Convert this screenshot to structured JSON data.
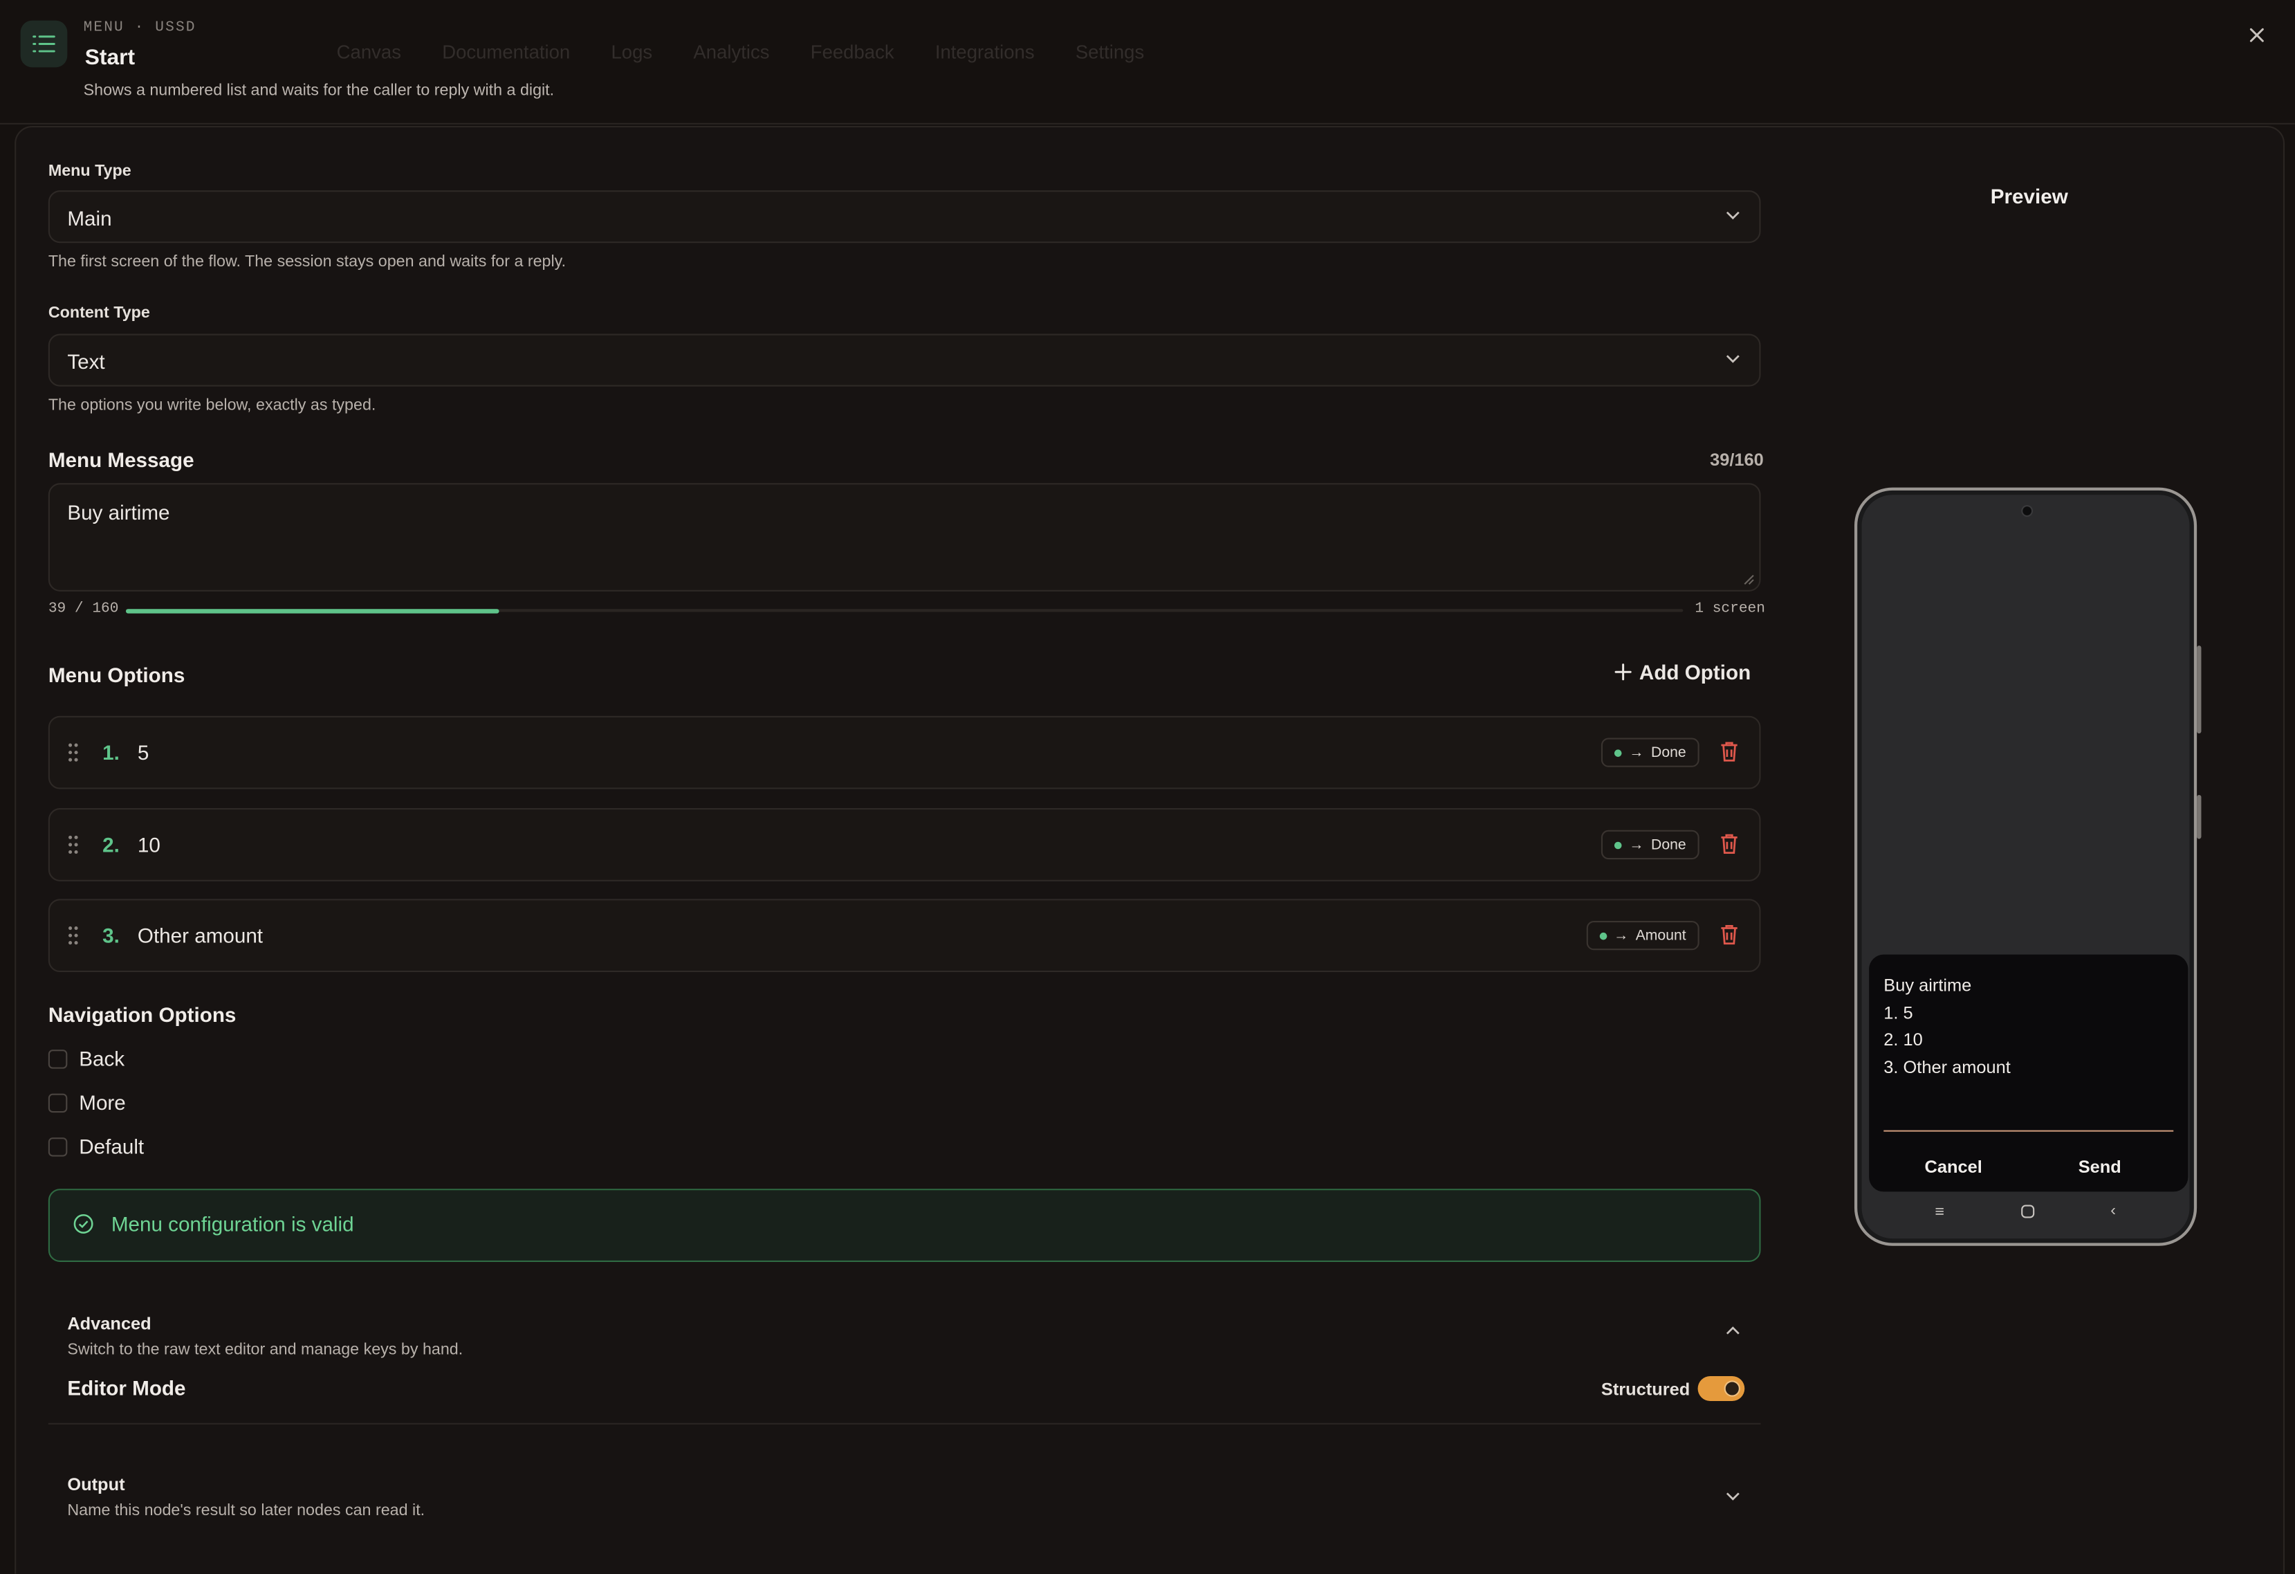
{
  "bg_nav": [
    "Canvas",
    "Documentation",
    "Logs",
    "Analytics",
    "Feedback",
    "Integrations",
    "Settings"
  ],
  "header": {
    "eyebrow": "MENU · USSD",
    "title": "Start",
    "subtitle": "Shows a numbered list and waits for the caller to reply with a digit."
  },
  "menu_type": {
    "label": "Menu Type",
    "value": "Main",
    "hint": "The first screen of the flow. The session stays open and waits for a reply."
  },
  "content_type": {
    "label": "Content Type",
    "value": "Text",
    "hint": "The options you write below, exactly as typed."
  },
  "menu_message": {
    "label": "Menu Message",
    "counter": "39/160",
    "value": "Buy airtime",
    "usage_text": "39 / 160",
    "usage_fraction": 0.24,
    "screens": "1 screen"
  },
  "menu_options": {
    "label": "Menu Options",
    "add_label": "Add Option",
    "items": [
      {
        "num": "1.",
        "label": "5",
        "target": "Done"
      },
      {
        "num": "2.",
        "label": "10",
        "target": "Done"
      },
      {
        "num": "3.",
        "label": "Other amount",
        "target": "Amount"
      }
    ]
  },
  "navigation": {
    "label": "Navigation Options",
    "items": [
      "Back",
      "More",
      "Default"
    ]
  },
  "validation": {
    "message": "Menu configuration is valid"
  },
  "advanced": {
    "title": "Advanced",
    "subtitle": "Switch to the raw text editor and manage keys by hand.",
    "editor_mode_label": "Editor Mode",
    "mode_value": "Structured"
  },
  "output": {
    "title": "Output",
    "subtitle": "Name this node's result so later nodes can read it."
  },
  "preview": {
    "title": "Preview",
    "lines": [
      "Buy airtime",
      "1. 5",
      "2. 10",
      "3. Other amount"
    ],
    "cancel": "Cancel",
    "send": "Send"
  },
  "colors": {
    "accent_green": "#5fc48a",
    "toggle_orange": "#e59a3c",
    "background": "#15110f"
  }
}
